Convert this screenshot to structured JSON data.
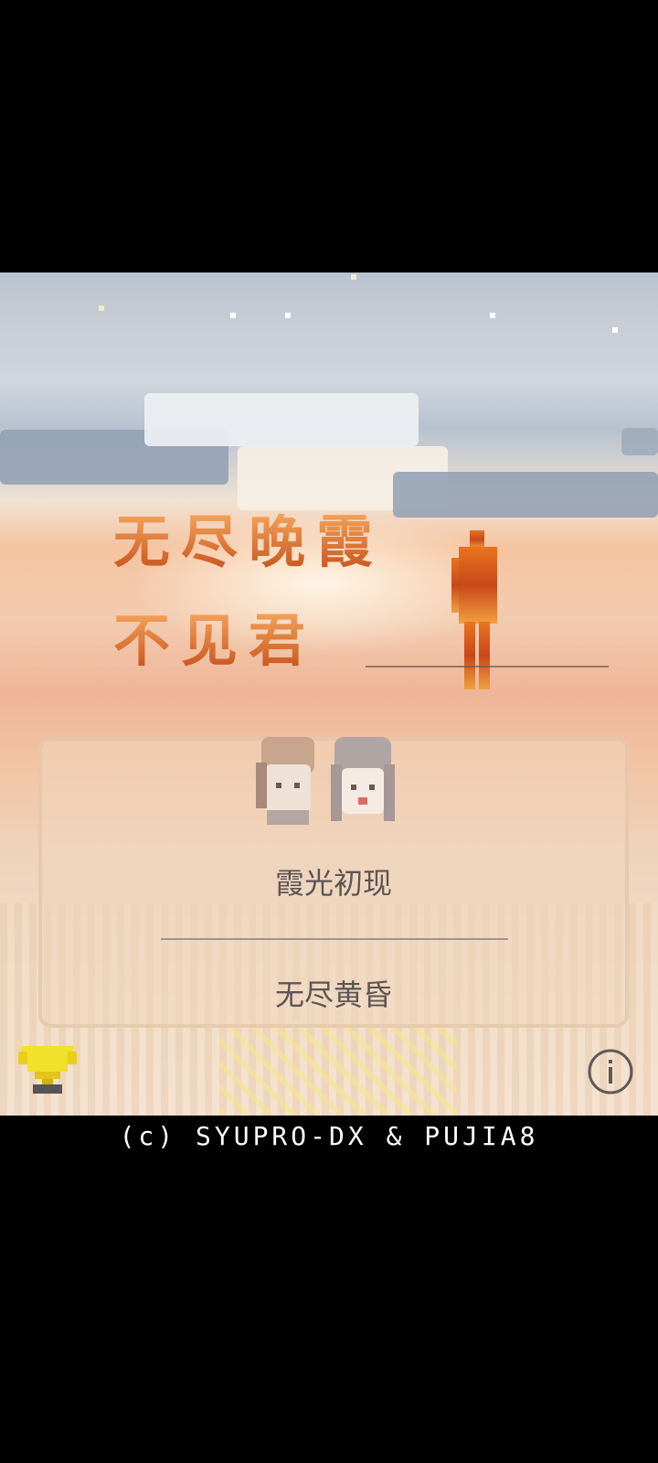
{
  "title": {
    "line1": "无尽晚霞",
    "line2": "不见君"
  },
  "menu": {
    "items": [
      {
        "label": "霞光初现"
      },
      {
        "label": "无尽黄昏"
      }
    ]
  },
  "icons": {
    "trophy": "trophy-icon",
    "info": "info-icon"
  },
  "footer": {
    "copyright": "(c) SYUPRO-DX & PUJIA8"
  },
  "colors": {
    "background": "#000000",
    "title_gradient_top": "#f3a25a",
    "title_gradient_bottom": "#c8551f",
    "menu_text": "#5b5553",
    "trophy": "#f2e12a"
  }
}
